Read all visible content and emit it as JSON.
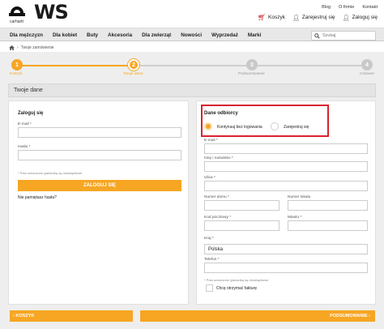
{
  "brand": {
    "name": "WS",
    "sub": "carhartt"
  },
  "toplinks": [
    "Blog",
    "O firmie",
    "Kontakt"
  ],
  "userlinks": {
    "cart": "Koszyk",
    "register": "Zarejestruj się",
    "login": "Zaloguj się"
  },
  "nav": {
    "items": [
      "Dla mężczyzn",
      "Dla kobiet",
      "Buty",
      "Akcesoria",
      "Dla zwierząt",
      "Nowości",
      "Wyprzedaż",
      "Marki"
    ],
    "search_placeholder": "Szukaj"
  },
  "breadcrumb": {
    "current": "Twoje zamówienie"
  },
  "steps": [
    {
      "num": "1",
      "label": "Koszyk",
      "state": "done"
    },
    {
      "num": "2",
      "label": "Twoje dane",
      "state": "current"
    },
    {
      "num": "3",
      "label": "Podsumowanie",
      "state": "todo"
    },
    {
      "num": "4",
      "label": "Gotowe!",
      "state": "todo"
    }
  ],
  "section_title": "Twoje dane",
  "login": {
    "title": "Zaloguj się",
    "email_label": "E-mail *",
    "password_label": "Hasło *",
    "required_note": "* Pola oznaczone gwiazdką są obowiązkowe",
    "button": "ZALOGUJ SIĘ",
    "forgot": "Nie pamiętasz hasła?"
  },
  "recipient": {
    "title": "Dane odbiorcy",
    "option_guest": "Kontynuuj bez logowania",
    "option_register": "Zarejestruj się",
    "email_label": "E-mail *",
    "name_label": "Imię i nazwisko *",
    "street_label": "Ulica *",
    "house_label": "Numer domu *",
    "flat_label": "Numer lokalu",
    "zip_label": "Kod pocztowy *",
    "city_label": "Miasto *",
    "country_label": "Kraj *",
    "country_value": "Polska",
    "phone_label": "Telefon *",
    "required_note": "* Pola oznaczone gwiazdką są obowiązkowe",
    "invoice_label": "Chcę otrzymać fakturę"
  },
  "bottom": {
    "back": "KOSZYK",
    "next": "PODSUMOWANIE"
  },
  "colors": {
    "accent": "#f6a623",
    "highlight": "#d9232e",
    "cart": "#d0202a"
  }
}
